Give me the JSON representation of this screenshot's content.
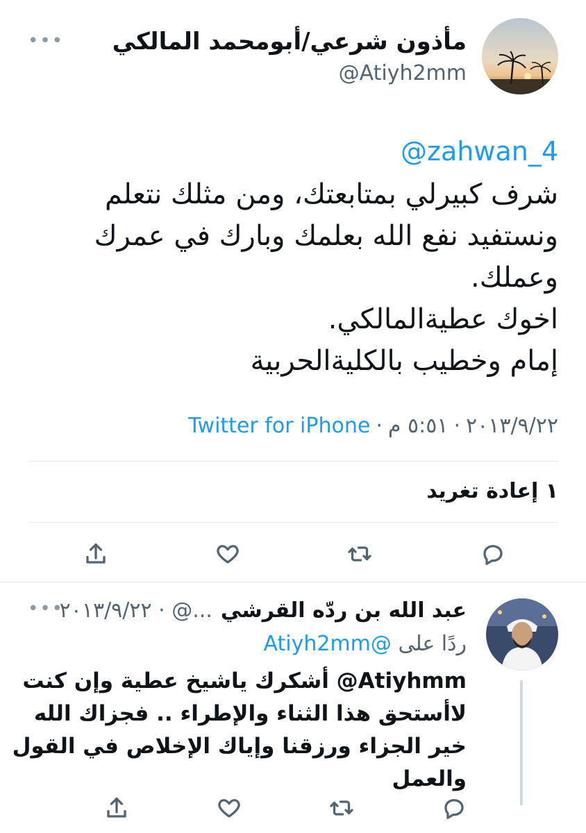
{
  "main_tweet": {
    "display_name": "مأذون شرعي/أبومحمد المالكي",
    "handle": "@Atiyh2mm",
    "more_icon": "more-dots-icon",
    "mention": "@zahwan_4",
    "body_lines": [
      "شرف كبيرلي بمتابعتك، ومن مثلك نتعلم",
      "ونستفيد نفع الله بعلمك وبارك في عمرك",
      "وعملك.",
      "اخوك عطيةالمالكي.",
      "إمام وخطيب بالكليةالحربية"
    ],
    "date": "٢٠١٣/٩/٢٢",
    "time": "٥:٥١ م",
    "separator": "·",
    "source": "Twitter for iPhone",
    "retweets_label": "١ إعادة تغريد",
    "actions": [
      "reply-icon",
      "retweet-icon",
      "like-icon",
      "share-icon"
    ]
  },
  "reply_tweet": {
    "display_name": "عبد الله بن ردّه القرشي",
    "handle_date": "...@ · ٢٠١٣/٩/٢٢",
    "replying_to_prefix": "ردًا على",
    "replying_to_handle": "@Atiyh2mm",
    "body_lines": [
      "Atiyhmm@ أشكرك ياشيخ عطية وإن كنت",
      "لاأستحق هذا الثناء والإطراء .. فجزاك الله",
      "خير الجزاء ورزقنا وإياك الإخلاص في القول",
      "والعمل"
    ],
    "actions": [
      "reply-icon",
      "retweet-icon",
      "like-icon",
      "share-icon"
    ]
  },
  "colors": {
    "accent": "#1d9bf0",
    "secondary_text": "#536471",
    "divider": "#e1e8ed"
  }
}
